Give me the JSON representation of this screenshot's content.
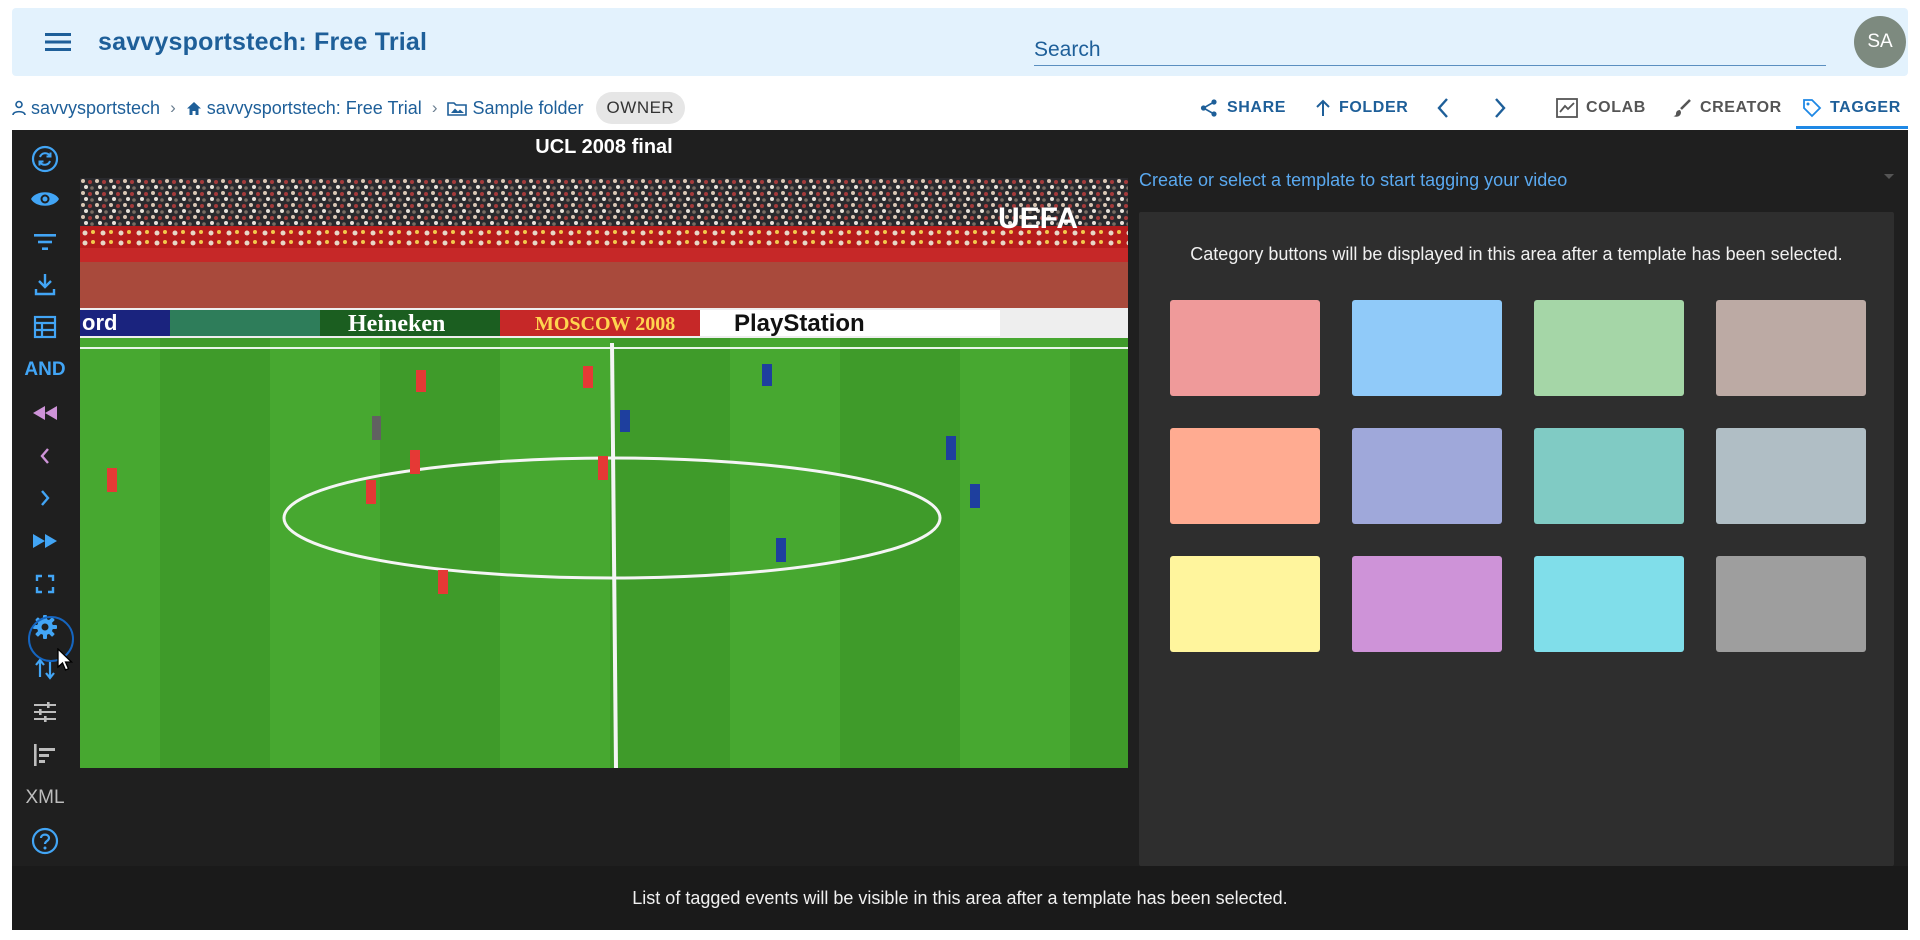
{
  "app": {
    "title": "savvysportstech: Free Trial"
  },
  "search": {
    "placeholder": "Search"
  },
  "user": {
    "initials": "SA"
  },
  "breadcrumb": {
    "items": [
      "savvysportstech",
      "savvysportstech: Free Trial",
      "Sample folder"
    ],
    "role": "OWNER"
  },
  "toolbar": {
    "share": "SHARE",
    "folder": "FOLDER",
    "colab": "COLAB",
    "creator": "CREATOR",
    "tagger": "TAGGER"
  },
  "sidebar": {
    "and_label": "AND",
    "xml_label": "XML"
  },
  "video": {
    "title": "UCL 2008 final",
    "overlay_logo": "UEFA",
    "ad_boards": [
      "ord",
      "Heineken",
      "MOSCOW 2008",
      "PlayStation"
    ]
  },
  "tagger": {
    "template_prompt": "Create or select a template to start tagging your video",
    "category_message": "Category buttons will be displayed in this area after a template has been selected.",
    "category_colors": [
      "#ef9a9a",
      "#90caf9",
      "#a5d6a7",
      "#bcaaa4",
      "#ffab91",
      "#9fa8da",
      "#80cbc4",
      "#b0bec5",
      "#fff59d",
      "#ce93d8",
      "#80deea",
      "#9e9e9e"
    ],
    "events_message": "List of tagged events will be visible in this area after a template has been selected."
  },
  "colors": {
    "accent": "#1e88e5",
    "brand_text": "#1e5f99",
    "appbar_bg": "#e3f2fd",
    "sidebar_icon": "#42a5f5",
    "rewind_icon": "#ce93d8"
  }
}
